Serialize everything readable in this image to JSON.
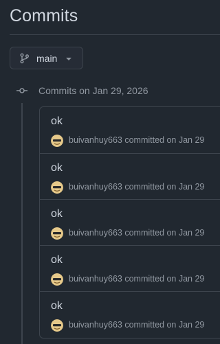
{
  "page": {
    "title": "Commits"
  },
  "branch": {
    "name": "main"
  },
  "group": {
    "label": "Commits on Jan 29, 2026"
  },
  "commits": [
    {
      "message": "ok",
      "author": "buivanhuy663",
      "action": "committed on Jan 29"
    },
    {
      "message": "ok",
      "author": "buivanhuy663",
      "action": "committed on Jan 29"
    },
    {
      "message": "ok",
      "author": "buivanhuy663",
      "action": "committed on Jan 29"
    },
    {
      "message": "ok",
      "author": "buivanhuy663",
      "action": "committed on Jan 29"
    },
    {
      "message": "ok",
      "author": "buivanhuy663",
      "action": "committed on Jan 29"
    }
  ],
  "icons": {
    "branch": "git-branch-icon",
    "caret": "chevron-down-icon",
    "timeline": "git-commit-icon",
    "avatar": "avatar"
  },
  "colors": {
    "background": "#212830",
    "border": "#3d444d",
    "text": "#d1d7e0",
    "muted": "#9198a1"
  }
}
